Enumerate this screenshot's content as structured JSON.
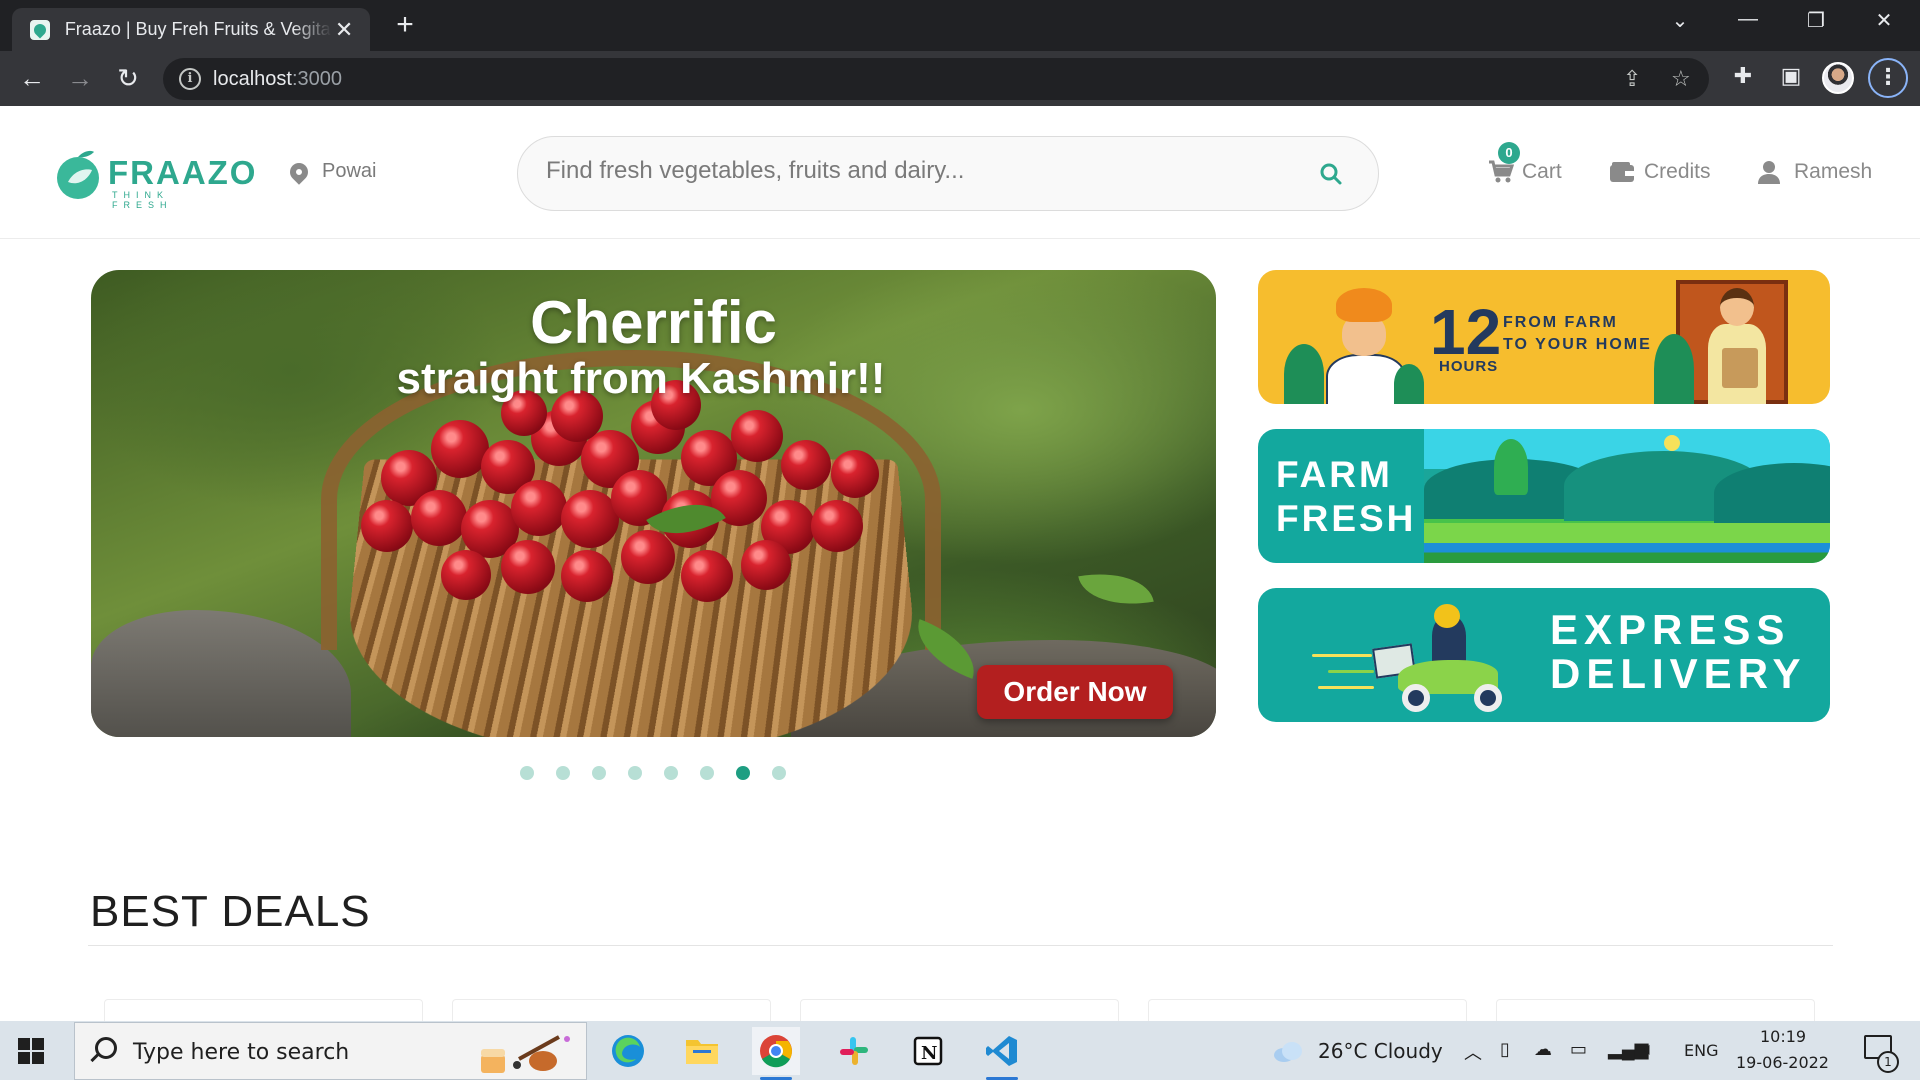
{
  "browser": {
    "tab_title": "Fraazo | Buy Freh Fruits & Vegitables",
    "tab_close": "✕",
    "new_tab": "+",
    "url_host": "localhost",
    "url_port": ":3000",
    "window_controls": [
      "⌄",
      "—",
      "❐",
      "✕"
    ]
  },
  "header": {
    "logo_text": "FRAAZO",
    "logo_tagline": "THINK FRESH",
    "location": "Powai",
    "search_placeholder": "Find fresh vegetables, fruits and dairy...",
    "cart_count": "0",
    "cart_label": "Cart",
    "credits_label": "Credits",
    "user_name": "Ramesh"
  },
  "hero": {
    "title": "Cherrific",
    "subtitle": "straight from Kashmir!!",
    "cta": "Order Now",
    "slide_count": 8,
    "active_slide": 6
  },
  "banners": {
    "hours_number": "12",
    "hours_label": "HOURS",
    "hours_text_line1": "FROM FARM",
    "hours_text_line2": "TO YOUR HOME",
    "farm_line1": "FARM",
    "farm_line2": "FRESH",
    "express_line1": "EXPRESS",
    "express_line2": "DELIVERY"
  },
  "sections": {
    "best_deals_title": "BEST DEALS"
  },
  "taskbar": {
    "search_placeholder": "Type here to search",
    "weather": "26°C  Cloudy",
    "language": "ENG",
    "time": "10:19",
    "date": "19-06-2022",
    "notification_count": "1",
    "apps": [
      "edge-icon",
      "file-explorer-icon",
      "chrome-icon",
      "slack-icon",
      "notion-icon",
      "vscode-icon"
    ]
  },
  "colors": {
    "brand": "#2ea88e",
    "banner_yellow": "#f6bd2e",
    "banner_teal": "#13a89e",
    "cta_red": "#b31f1f"
  }
}
